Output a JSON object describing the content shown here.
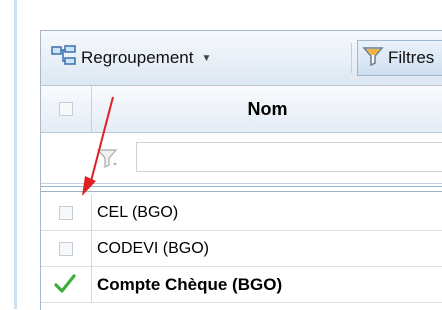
{
  "toolbar": {
    "group_label": "Regroupement",
    "filter_label": "Filtres"
  },
  "grid": {
    "column_header": "Nom",
    "rows": [
      {
        "name": "CEL (BGO)",
        "selected": false
      },
      {
        "name": "CODEVI (BGO)",
        "selected": false
      },
      {
        "name": "Compte Chèque (BGO)",
        "selected": true
      }
    ]
  },
  "colors": {
    "accent": "#e02020",
    "check": "#3cae3c",
    "toolbar_bg": "#dde7f2"
  }
}
